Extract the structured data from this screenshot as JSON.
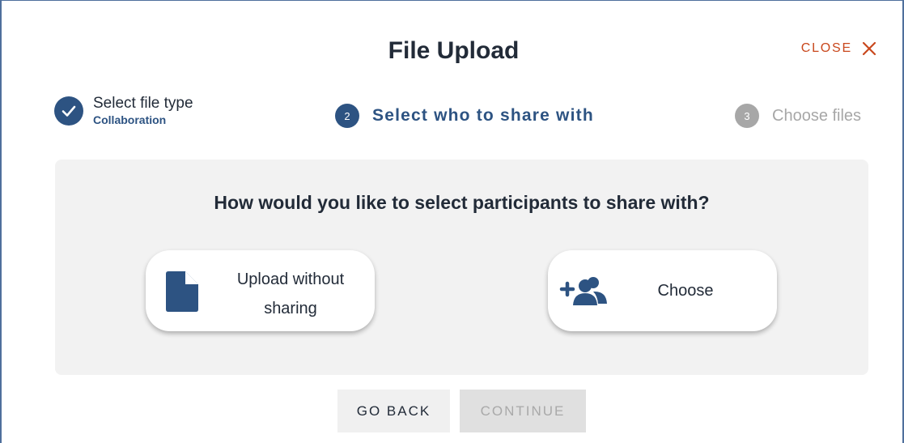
{
  "dialog": {
    "title": "File Upload",
    "close_label": "CLOSE"
  },
  "stepper": {
    "steps": [
      {
        "label": "Select file type",
        "sublabel": "Collaboration",
        "status": "completed"
      },
      {
        "number": "2",
        "label": "Select who to share with",
        "status": "active"
      },
      {
        "number": "3",
        "label": "Choose files",
        "status": "inactive"
      }
    ]
  },
  "panel": {
    "question": "How would you like to select participants to share with?",
    "options": [
      {
        "label_line1": "Upload without",
        "label_line2": "sharing",
        "icon": "file-icon"
      },
      {
        "label": "Choose",
        "icon": "add-group-icon"
      }
    ]
  },
  "buttons": {
    "back_label": "GO BACK",
    "continue_label": "CONTINUE"
  },
  "colors": {
    "primary": "#2d5382",
    "close": "#c9481d",
    "inactive": "#a7a7a7",
    "panel_bg": "#f2f2f2"
  }
}
